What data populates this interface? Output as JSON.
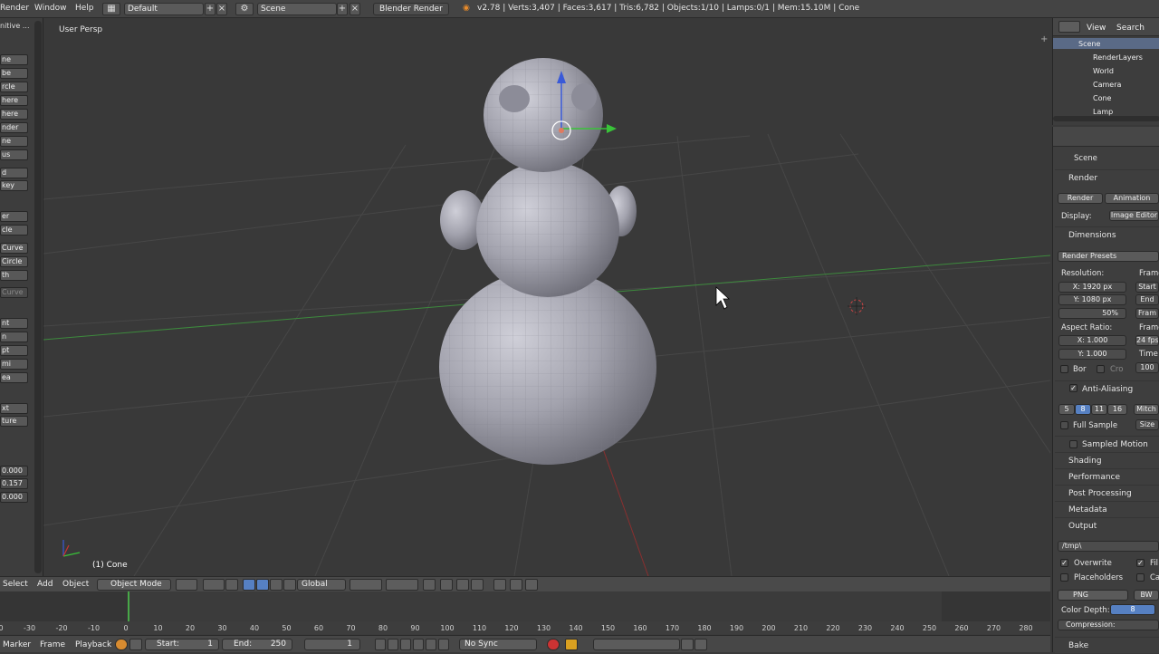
{
  "topbar": {
    "menus": [
      "Render",
      "Window",
      "Help"
    ],
    "screen_layout": "Default",
    "scene": "Scene",
    "engine": "Blender Render",
    "stats": "v2.78 | Verts:3,407 | Faces:3,617 | Tris:6,782 | Objects:1/10 | Lamps:0/1 | Mem:15.10M | Cone"
  },
  "toolshelf": {
    "top_label": "nitive ...",
    "items": [
      "ne",
      "be",
      "rcle",
      "here",
      "here",
      "nder",
      "ne",
      "us",
      "d",
      "key",
      "er",
      "cle",
      "Curve",
      "Circle",
      "th",
      "Curve",
      "nt",
      "n",
      "pt",
      "mi",
      "ea",
      "xt",
      "ture"
    ],
    "values": [
      "0.000",
      "0.157",
      "0.000"
    ]
  },
  "viewport": {
    "view_name": "User Persp",
    "object_label": "(1) Cone"
  },
  "view3d_header": {
    "menus": [
      "Select",
      "Add",
      "Object"
    ],
    "mode": "Object Mode",
    "orientation": "Global"
  },
  "timeline": {
    "ticks": [
      "-40",
      "-30",
      "-20",
      "-10",
      "0",
      "10",
      "20",
      "30",
      "40",
      "50",
      "60",
      "70",
      "80",
      "90",
      "100",
      "110",
      "120",
      "130",
      "140",
      "150",
      "160",
      "170",
      "180",
      "190",
      "200",
      "210",
      "220",
      "230",
      "240",
      "250",
      "260",
      "270",
      "280"
    ],
    "menus": [
      "Marker",
      "Frame",
      "Playback"
    ],
    "start_label": "Start:",
    "start_value": "1",
    "end_label": "End:",
    "end_value": "250",
    "current_frame": "1",
    "sync": "No Sync"
  },
  "outliner": {
    "menus": [
      "View",
      "Search"
    ],
    "items": [
      "Scene",
      "RenderLayers",
      "World",
      "Camera",
      "Cone",
      "Lamp"
    ]
  },
  "properties": {
    "context": "Scene",
    "render_panel": "Render",
    "render_btn": "Render",
    "animation_btn": "Animation",
    "display_label": "Display:",
    "display_value": "Image Editor",
    "dimensions_panel": "Dimensions",
    "render_presets": "Render Presets",
    "resolution_label": "Resolution:",
    "frame_label": "Frame",
    "res_x": "X:  1920 px",
    "res_y": "Y:  1080 px",
    "res_pct": "50%",
    "start_short": "Start",
    "end_short": "End",
    "frame_short": "Fram",
    "aspect_label": "Aspect Ratio:",
    "frame_rate_label": "Frame",
    "asp_x": "X:  1.000",
    "asp_y": "Y:  1.000",
    "fps": "24 fps",
    "time_label": "Time",
    "border_label": "Bor",
    "crop_label": "Cro",
    "time_value": "100",
    "aa_panel": "Anti-Aliasing",
    "aa_samples": [
      "5",
      "8",
      "11",
      "16"
    ],
    "aa_filter": "Mitch",
    "full_sample": "Full Sample",
    "size_label": "Size",
    "motion_blur": "Sampled Motion Blur",
    "shading": "Shading",
    "performance": "Performance",
    "post_processing": "Post Processing",
    "metadata": "Metadata",
    "output_panel": "Output",
    "output_path": "/tmp\\",
    "overwrite": "Overwrite",
    "file_ext": "Fil",
    "placeholders": "Placeholders",
    "cache": "Ca",
    "format": "PNG",
    "color_bw": "BW",
    "color_depth_label": "Color Depth:",
    "color_depth": "8",
    "compression": "Compression:",
    "bake": "Bake"
  }
}
